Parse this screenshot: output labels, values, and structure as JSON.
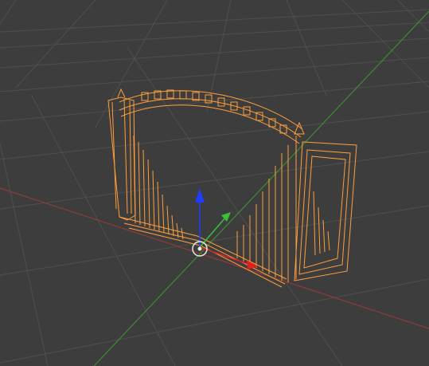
{
  "viewport": {
    "background_color": "#3d3d3d",
    "grid_color": "#4f4f4f",
    "x_axis_color": "#9a3b3b",
    "y_axis_color": "#4a8f3a",
    "selection_wire_color": "#ff9f3a",
    "gizmo_z_color": "#1f3cff",
    "gizmo_y_color": "#38c038",
    "gizmo_x_color": "#e02020",
    "pivot_color": "#e8e8e8"
  },
  "object": {
    "selected": true,
    "description_icon": "gate-mesh-wireframe"
  }
}
